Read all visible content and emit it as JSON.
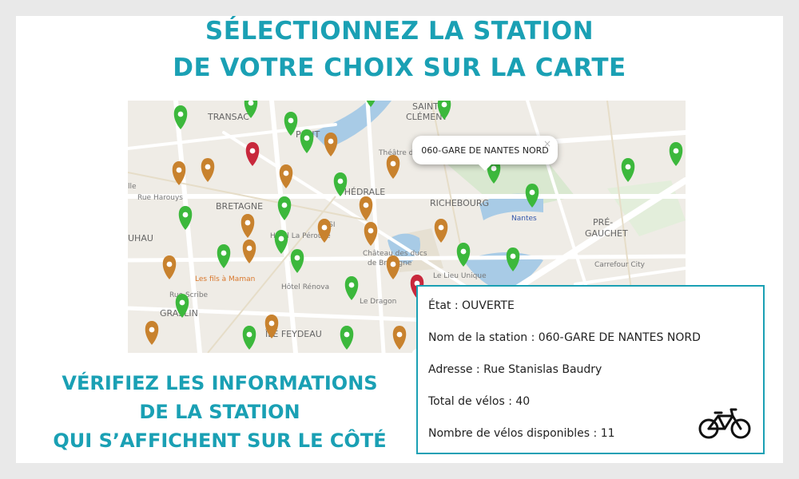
{
  "title": {
    "line1": "SÉLECTIONNEZ LA STATION",
    "line2": "DE VOTRE CHOIX SUR LA CARTE"
  },
  "map": {
    "popup": {
      "text": "060-GARE DE NANTES NORD",
      "close": "×"
    },
    "labels": [
      {
        "id": "saint-clement",
        "text": "SAINT-",
        "cls": "big"
      },
      {
        "id": "clement",
        "text": "CLÉMENT",
        "cls": "big"
      },
      {
        "id": "tranas",
        "text": "TRANSAC",
        "cls": "big"
      },
      {
        "id": "pont",
        "text": "PONT",
        "cls": "big"
      },
      {
        "id": "theatre",
        "text": "Théâtre du G",
        "cls": "small"
      },
      {
        "id": "cathedrale",
        "text": "THÉDRALE",
        "cls": "big"
      },
      {
        "id": "richebourg",
        "text": "RICHEBOURG",
        "cls": "big"
      },
      {
        "id": "nantes",
        "text": "Nantes",
        "cls": "blue"
      },
      {
        "id": "pre",
        "text": "PRÉ-",
        "cls": "big"
      },
      {
        "id": "gauchet",
        "text": "GAUCHET",
        "cls": "big"
      },
      {
        "id": "carrefour",
        "text": "Carrefour City",
        "cls": "small"
      },
      {
        "id": "bretagne",
        "text": "BRETAGNE",
        "cls": "big"
      },
      {
        "id": "rue-harouys",
        "text": "Rue Harouys",
        "cls": "small"
      },
      {
        "id": "ille",
        "text": "lle",
        "cls": "small"
      },
      {
        "id": "uhau",
        "text": "UHAU",
        "cls": "big"
      },
      {
        "id": "epsi",
        "text": "EPSI",
        "cls": "small"
      },
      {
        "id": "hotel-perouse",
        "text": "Hôtel La Pérouse",
        "cls": "small"
      },
      {
        "id": "chateau1",
        "text": "Château des ducs",
        "cls": "small"
      },
      {
        "id": "chateau2",
        "text": "de Bretagne",
        "cls": "small"
      },
      {
        "id": "lieu-unique",
        "text": "Le Lieu Unique",
        "cls": "small"
      },
      {
        "id": "fils-maman",
        "text": "Les fils à Maman",
        "cls": "orange"
      },
      {
        "id": "hotel-renova",
        "text": "Hôtel Rénova",
        "cls": "small"
      },
      {
        "id": "rue-scribe",
        "text": "Rue Scribe",
        "cls": "small"
      },
      {
        "id": "dragon",
        "text": "Le Dragon",
        "cls": "small"
      },
      {
        "id": "graslin",
        "text": "GRASLIN",
        "cls": "big"
      },
      {
        "id": "feydeau",
        "text": "ÎLE FEYDEAU",
        "cls": "big"
      }
    ]
  },
  "subtitle": {
    "line1": "VÉRIFIEZ LES INFORMATIONS",
    "line2": "DE LA STATION",
    "line3": "QUI S’AFFICHENT SUR LE CÔTÉ"
  },
  "info": {
    "etat": "État : OUVERTE",
    "nom": "Nom de la station : 060-GARE DE NANTES NORD",
    "adresse": "Adresse : Rue Stanislas Baudry",
    "total": "Total de vélos : 40",
    "disponibles": "Nombre de vélos disponibles : 11"
  },
  "colors": {
    "accent": "#1aa0b4",
    "marker_green": "#3cb83c",
    "marker_orange": "#c8822e",
    "marker_red": "#c8283c"
  },
  "icons": {
    "bike": "bicycle-icon",
    "marker": "map-marker-icon"
  }
}
